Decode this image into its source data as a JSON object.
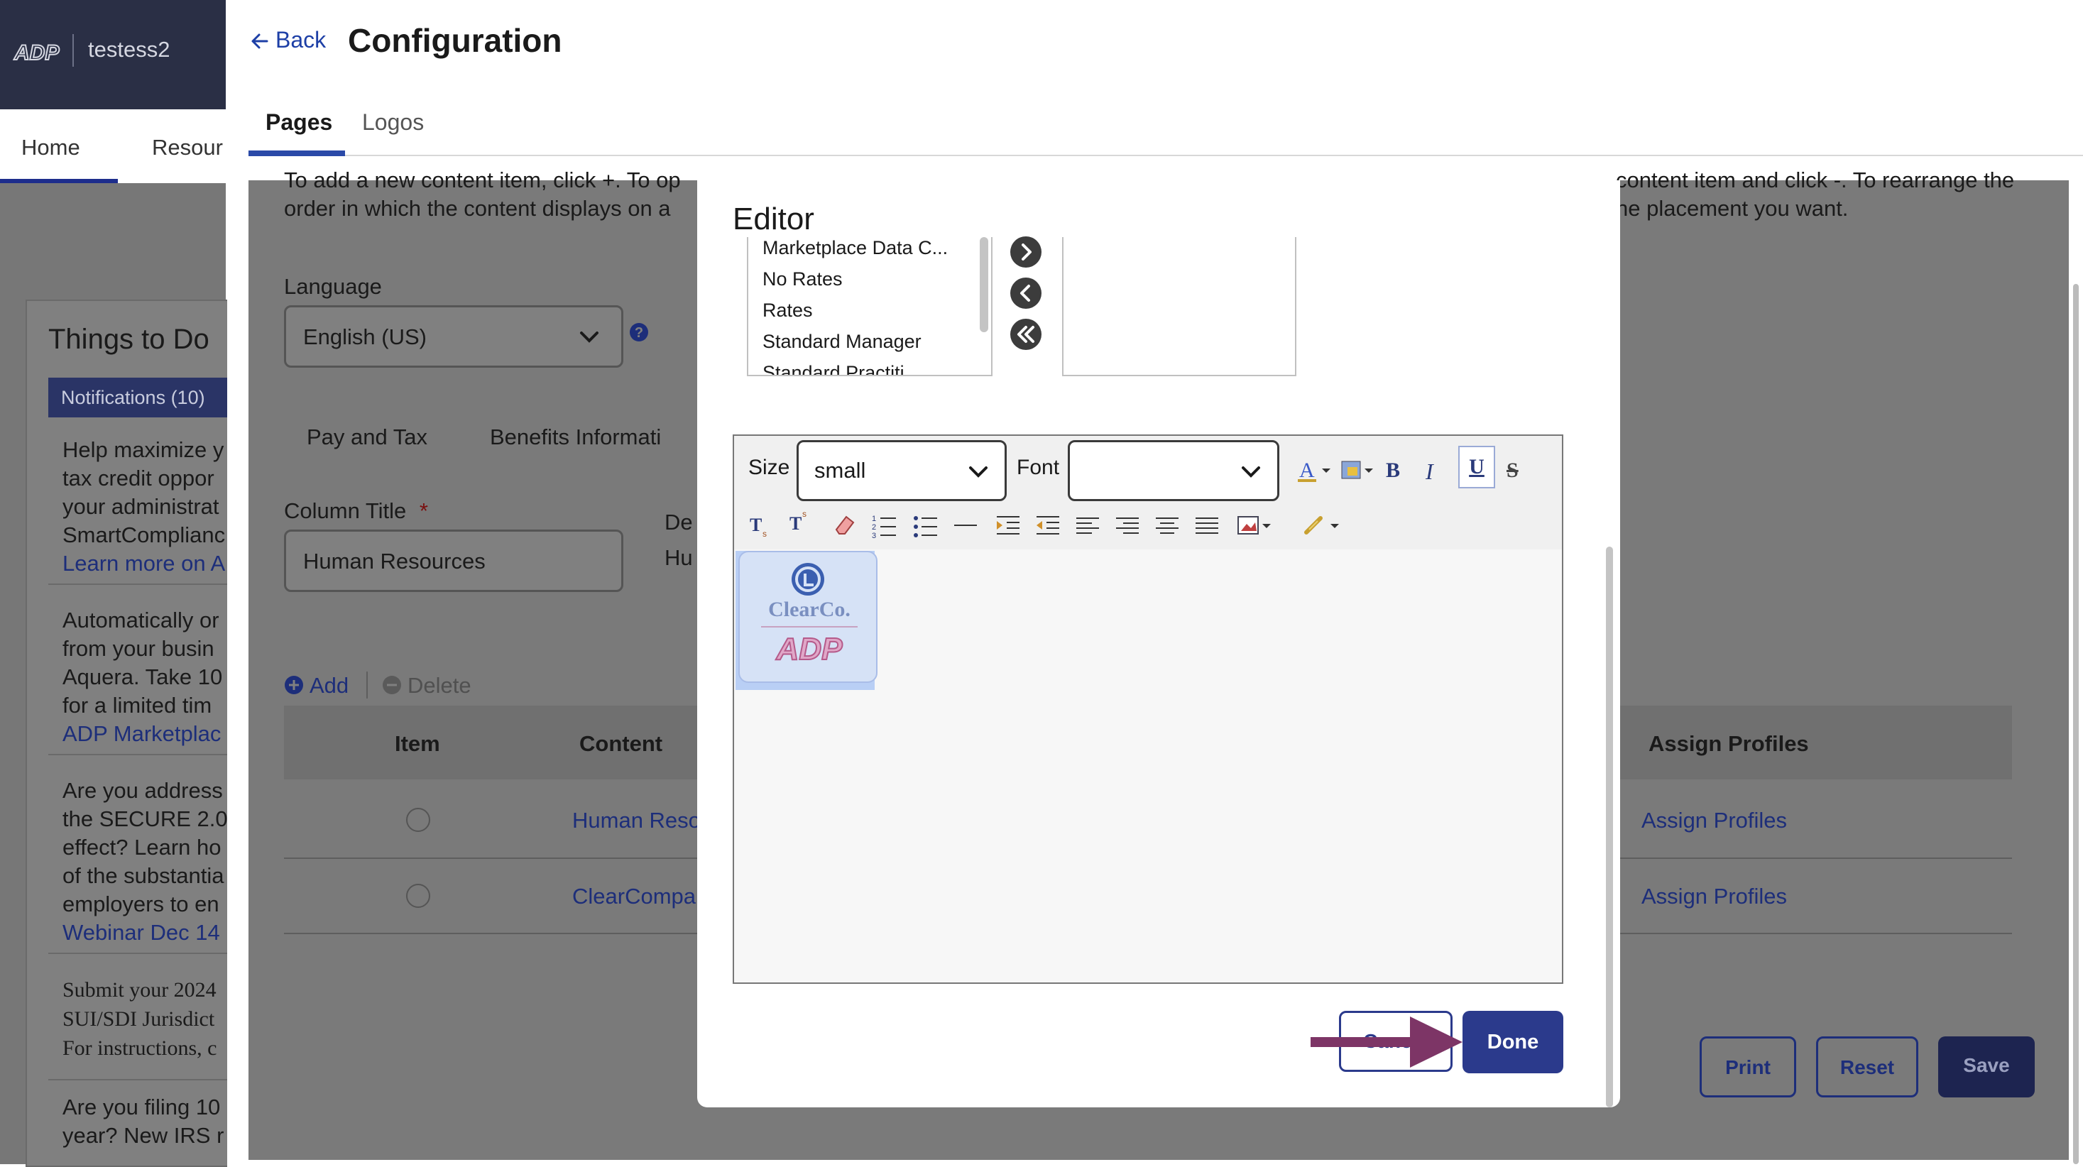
{
  "app": {
    "company_name": "testess2"
  },
  "left_nav": {
    "items": [
      {
        "label": "Home"
      },
      {
        "label": "Resour"
      }
    ]
  },
  "things_to_do": {
    "title": "Things to Do",
    "notifications_tab": "Notifications (10)",
    "notifications": [
      {
        "lines": [
          "Help maximize y",
          "tax credit oppor",
          "your administrat",
          "SmartComplianc"
        ],
        "link": "Learn more on A"
      },
      {
        "lines": [
          "Automatically or",
          "from your busin",
          "Aquera. Take 10",
          "for a limited tim"
        ],
        "link": "ADP Marketplac"
      },
      {
        "lines": [
          "Are you address",
          "the SECURE 2.0",
          "effect? Learn ho",
          "of the substantia",
          "employers to en"
        ],
        "link": "Webinar Dec 14"
      },
      {
        "lines": [
          "Submit your 2024",
          "SUI/SDI Jurisdict",
          "For instructions, c"
        ],
        "link": ""
      },
      {
        "lines": [
          "Are you filing 10",
          "year? New IRS r"
        ],
        "link": ""
      }
    ]
  },
  "header": {
    "back_label": "Back",
    "title": "Configuration",
    "tabs": [
      {
        "label": "Pages"
      },
      {
        "label": "Logos"
      }
    ]
  },
  "main": {
    "intro_line1_left": "To add a new content item, click +. To op",
    "intro_line1_right": "content item and click -. To rearrange the",
    "intro_line2_left": "order in which the content displays on a",
    "intro_line2_right": "he placement you want.",
    "language_label": "Language",
    "language_value": "English (US)",
    "page_tabs": [
      {
        "label": "Pay and Tax"
      },
      {
        "label": "Benefits Informati"
      }
    ],
    "column_title_label": "Column Title",
    "required_mark": "*",
    "column_title_value": "Human Resources",
    "desc_label_partial": "De",
    "desc_value_partial": "Hu",
    "add_label": "Add",
    "delete_label": "Delete",
    "table": {
      "headers": [
        "Item",
        "Content",
        "Assign Profiles"
      ],
      "rows": [
        {
          "content": "Human Reso",
          "assign": "Assign Profiles"
        },
        {
          "content": "ClearCompa",
          "assign": "Assign Profiles"
        }
      ]
    },
    "buttons": {
      "print": "Print",
      "reset": "Reset",
      "save": "Save"
    }
  },
  "modal": {
    "title": "Editor",
    "list_items": [
      "Marketplace Data C...",
      "No Rates",
      "Rates",
      "Standard Manager",
      "Standard Practiti"
    ],
    "editor": {
      "size_label": "Size",
      "size_value": "small",
      "font_label": "Font",
      "font_value": "",
      "bold": "B",
      "italic": "I",
      "underline": "U",
      "strike": "S",
      "image_text_top": "ClearCo.",
      "image_text_bottom": "ADP"
    },
    "cancel_label": "Cancel",
    "done_label": "Done"
  },
  "colors": {
    "brand_dark": "#2a2f45",
    "primary": "#2b3a8c",
    "link": "#1d3fa6",
    "overlay": "#7a7a7a",
    "annotation_arrow": "#7d3566"
  },
  "icons": [
    "adp-logo-icon",
    "back-arrow-icon",
    "chevron-down-icon",
    "help-icon",
    "plus-circle-icon",
    "minus-circle-icon",
    "chevron-right-icon",
    "chevron-left-icon",
    "double-chevron-left-icon",
    "font-color-icon",
    "highlight-icon",
    "subscript-icon",
    "superscript-icon",
    "eraser-icon",
    "ordered-list-icon",
    "unordered-list-icon",
    "horizontal-rule-icon",
    "indent-icon",
    "outdent-icon",
    "align-left-icon",
    "align-right-icon",
    "align-center-icon",
    "align-justify-icon",
    "insert-image-icon",
    "insert-link-icon",
    "arrow-annotation-icon"
  ]
}
